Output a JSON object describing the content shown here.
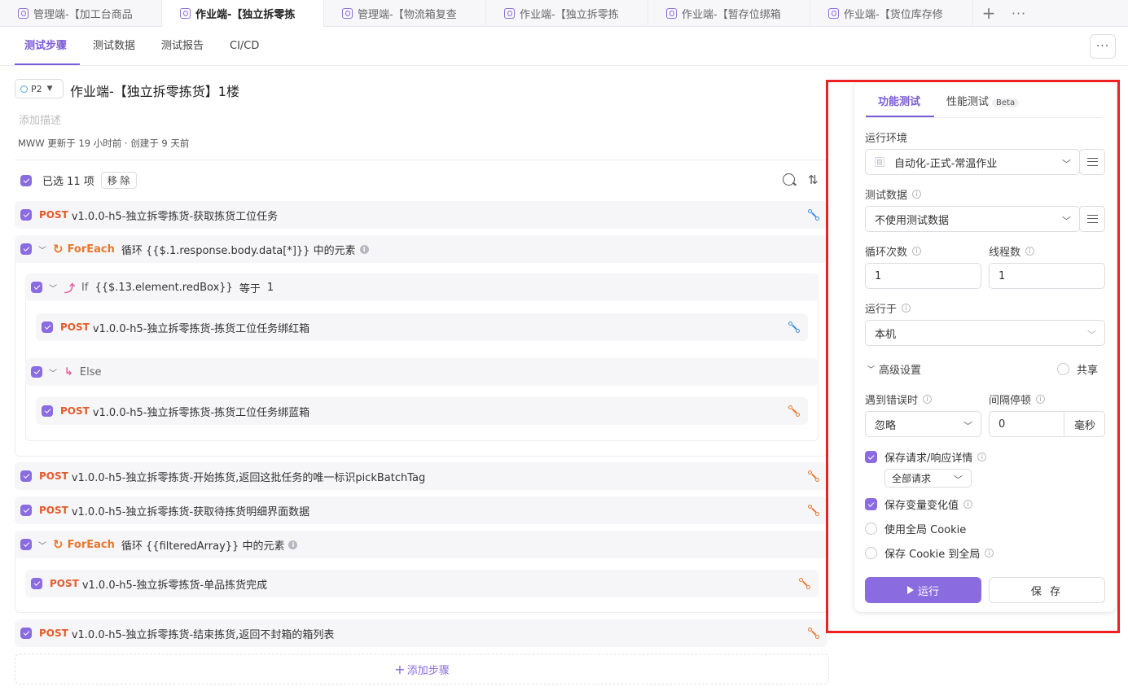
{
  "file_tabs": [
    {
      "label": "管理端-【加工台商品"
    },
    {
      "label": "作业端-【独立拆零拣"
    },
    {
      "label": "管理端-【物流箱复查"
    },
    {
      "label": "作业端-【独立拆零拣"
    },
    {
      "label": "作业端-【暂存位绑箱"
    },
    {
      "label": "作业端-【货位库存修"
    }
  ],
  "sub_tabs": [
    "测试步骤",
    "测试数据",
    "测试报告",
    "CI/CD"
  ],
  "case": {
    "priority": "P2",
    "title": "作业端-【独立拆零拣货】1楼",
    "description_placeholder": "添加描述",
    "meta": "MWW 更新于 19 小时前 · 创建于 9 天前"
  },
  "selection": {
    "text": "已选 11 项",
    "remove_label": "移 除"
  },
  "steps": [
    {
      "method": "POST",
      "path": "v1.0.0-h5-独立拆零拣货-获取拣货工位任务"
    },
    {
      "keyword": "ForEach",
      "text": "循环 {{$.1.response.body.data[*]}} 中的元素"
    },
    {
      "keyword": "If",
      "cond": "{{$.13.element.redBox}}",
      "op": "等于",
      "value": "1"
    },
    {
      "method": "POST",
      "path": "v1.0.0-h5-独立拆零拣货-拣货工位任务绑红箱"
    },
    {
      "keyword": "Else"
    },
    {
      "method": "POST",
      "path": "v1.0.0-h5-独立拆零拣货-拣货工位任务绑蓝箱"
    },
    {
      "method": "POST",
      "path": "v1.0.0-h5-独立拆零拣货-开始拣货,返回这批任务的唯一标识pickBatchTag"
    },
    {
      "method": "POST",
      "path": "v1.0.0-h5-独立拆零拣货-获取待拣货明细界面数据"
    },
    {
      "keyword": "ForEach",
      "text": "循环 {{filteredArray}} 中的元素"
    },
    {
      "method": "POST",
      "path": "v1.0.0-h5-独立拆零拣货-单品拣货完成"
    },
    {
      "method": "POST",
      "path": "v1.0.0-h5-独立拆零拣货-结束拣货,返回不封箱的箱列表"
    }
  ],
  "add_step_label": "添加步骤",
  "panel": {
    "tabs": [
      "功能测试",
      "性能测试"
    ],
    "beta": "Beta",
    "env_label": "运行环境",
    "env_value": "自动化-正式-常温作业",
    "data_label": "测试数据",
    "data_value": "不使用测试数据",
    "loop_label": "循环次数",
    "loop_value": "1",
    "threads_label": "线程数",
    "threads_value": "1",
    "run_on_label": "运行于",
    "run_on_value": "本机",
    "advanced_label": "高级设置",
    "share_label": "共享",
    "on_error_label": "遇到错误时",
    "on_error_value": "忽略",
    "interval_label": "间隔停顿",
    "interval_value": "0",
    "interval_unit": "毫秒",
    "save_details_label": "保存请求/响应详情",
    "save_details_scope": "全部请求",
    "save_vars_label": "保存变量变化值",
    "global_cookie_label": "使用全局 Cookie",
    "save_cookie_label": "保存 Cookie 到全局",
    "run_label": "运行",
    "save_label": "保 存"
  },
  "colors": {
    "accent": "#8b6be0",
    "method_post": "#e55a2b",
    "foreach": "#e8772e",
    "highlight": "#ef2020"
  }
}
